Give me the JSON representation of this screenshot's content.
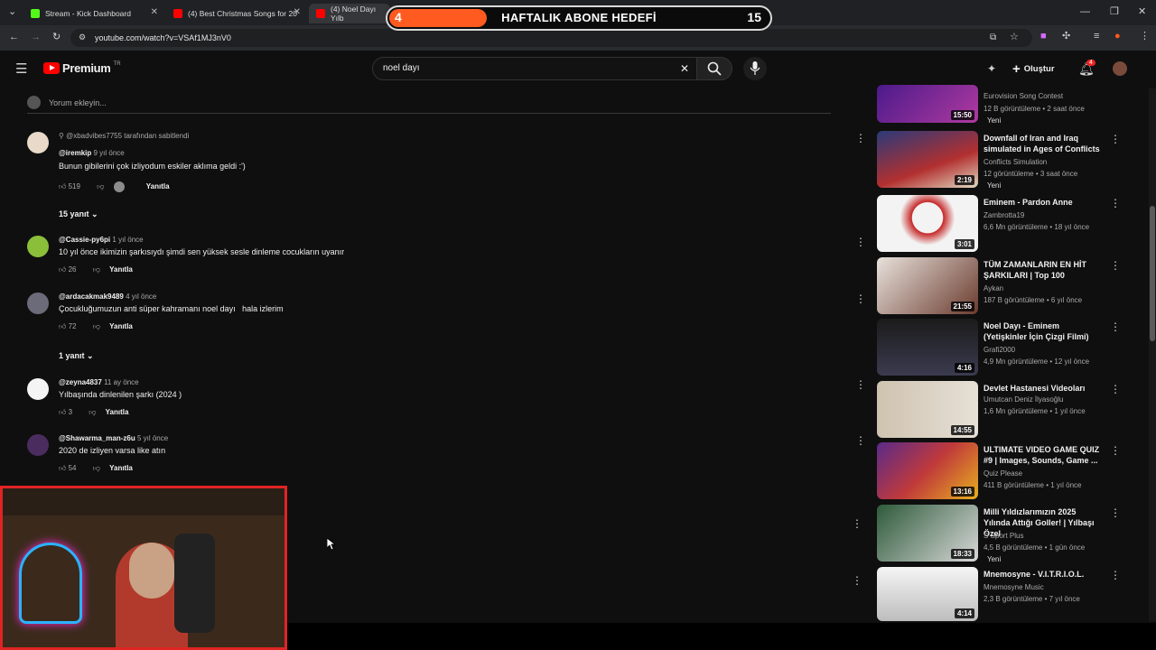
{
  "browser": {
    "tabs": [
      {
        "title": "Stream - Kick Dashboard",
        "color": "#53fc18"
      },
      {
        "title": "(4) Best Christmas Songs for 20",
        "color": "#ff0000"
      },
      {
        "title": "(4) Noel Dayı Yılb",
        "color": "#ff0000"
      }
    ],
    "url": "youtube.com/watch?v=VSAf1MJ3nV0"
  },
  "overlay": {
    "current": "4",
    "title": "HAFTALIK ABONE HEDEFİ",
    "target": "15",
    "progress": 0.27
  },
  "youtube": {
    "logo": "Premium",
    "region": "TR",
    "search_value": "noel dayı",
    "create_label": "Oluştur",
    "notif_count": "4",
    "add_comment": "Yorum ekleyin..."
  },
  "comments": [
    {
      "pinned": "@xbadvibes7755 tarafından sabitlendi",
      "author": "@iremkip",
      "time": "9 yıl önce",
      "text": "Bunun gibilerini çok izliyodum eskiler aklıma geldi :')",
      "likes": "519",
      "reply": "Yanıtla",
      "replies": "15 yanıt"
    },
    {
      "author": "@Cassie-py6pi",
      "time": "1 yıl önce",
      "text": "10 yıl önce ikimizin şarkısıydı şimdi sen yüksek sesle dinleme cocukların uyanır",
      "likes": "26",
      "reply": "Yanıtla"
    },
    {
      "author": "@ardacakmak9489",
      "time": "4 yıl önce",
      "text": "Çocukluğumuzun anti süper kahramanı noel dayı   hala izlerim",
      "likes": "72",
      "reply": "Yanıtla",
      "replies": "1 yanıt"
    },
    {
      "author": "@zeyna4837",
      "time": "11 ay önce",
      "text": "Yılbaşında dinlenilen şarkı (2024 )",
      "likes": "3",
      "reply": "Yanıtla"
    },
    {
      "author": "@Shawarma_man-z6u",
      "time": "5 yıl önce",
      "text": "2020 de izliyen varsa like atın",
      "likes": "54",
      "reply": "Yanıtla"
    }
  ],
  "videos": [
    {
      "title": "",
      "channel": "Eurovision Song Contest",
      "meta": "12 B görüntüleme • 2 saat önce",
      "badge": "Yeni",
      "duration": "15:50"
    },
    {
      "title": "Downfall of Iran and Iraq simulated in Ages of Conflicts",
      "channel": "Conflicts Simulation",
      "meta": "12 görüntüleme • 3 saat önce",
      "badge": "Yeni",
      "duration": "2:19"
    },
    {
      "title": "Eminem - Pardon Anne",
      "channel": "Zambrotta19",
      "meta": "6,6 Mn görüntüleme • 18 yıl önce",
      "badge": "",
      "duration": "3:01"
    },
    {
      "title": "TÜM ZAMANLARIN EN HİT ŞARKILARI |  Top 100",
      "channel": "Aykan",
      "meta": "187 B görüntüleme • 6 yıl önce",
      "badge": "",
      "duration": "21:55"
    },
    {
      "title": "Noel Dayı - Eminem (Yetişkinler İçin Çizgi Filmi)",
      "channel": "Grafi2000",
      "meta": "4,9 Mn görüntüleme • 12 yıl önce",
      "badge": "",
      "duration": "4:16"
    },
    {
      "title": "Devlet Hastanesi Videoları",
      "channel": "Umutcan Deniz İlyasoğlu",
      "meta": "1,6 Mn görüntüleme • 1 yıl önce",
      "badge": "",
      "duration": "14:55"
    },
    {
      "title": "ULTIMATE VIDEO GAME QUIZ #9 | Images, Sounds, Game ...",
      "channel": "Quiz Please",
      "meta": "411 B görüntüleme • 1 yıl önce",
      "badge": "",
      "duration": "13:16"
    },
    {
      "title": "Milli Yıldızlarımızın 2025 Yılında Attığı Goller! | Yılbaşı Özel",
      "channel": "S Sport Plus",
      "meta": "4,5 B görüntüleme • 1 gün önce",
      "badge": "Yeni",
      "duration": "18:33"
    },
    {
      "title": "Mnemosyne - V.I.T.R.I.O.L.",
      "channel": "Mnemosyne Music",
      "meta": "2,3 B görüntüleme • 7 yıl önce",
      "badge": "",
      "duration": "4:14"
    }
  ],
  "colors": {
    "bg": "#0f0f0f",
    "accent": "#ff0000",
    "overlay_fill": "#ff5a1f"
  }
}
